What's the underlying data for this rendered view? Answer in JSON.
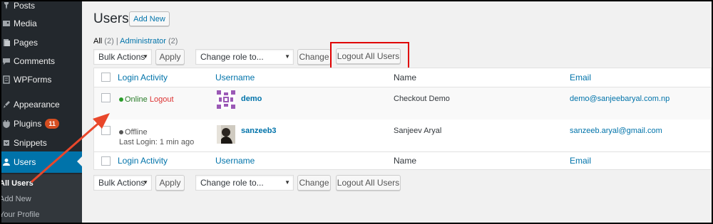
{
  "sidebar": {
    "items": [
      {
        "label": "Posts",
        "icon": "pin-icon"
      },
      {
        "label": "Media",
        "icon": "media-icon"
      },
      {
        "label": "Pages",
        "icon": "pages-icon"
      },
      {
        "label": "Comments",
        "icon": "comments-icon"
      },
      {
        "label": "WPForms",
        "icon": "forms-icon"
      },
      {
        "label": "Appearance",
        "icon": "appearance-icon"
      },
      {
        "label": "Plugins",
        "icon": "plugins-icon",
        "badge": "11"
      },
      {
        "label": "Snippets",
        "icon": "snippets-icon"
      },
      {
        "label": "Users",
        "icon": "users-icon",
        "current": true
      }
    ],
    "submenu": [
      "All Users",
      "Add New",
      "Your Profile"
    ]
  },
  "page": {
    "title": "Users",
    "add_new_label": "Add New"
  },
  "filters": {
    "all_label": "All",
    "all_count": "(2)",
    "separator": "|",
    "admin_label": "Administrator",
    "admin_count": "(2)"
  },
  "top_actions": {
    "bulk_actions": "Bulk Actions",
    "apply": "Apply",
    "change_role": "Change role to...",
    "change": "Change",
    "logout_all": "Logout All Users"
  },
  "bottom_actions": {
    "bulk_actions": "Bulk Actions",
    "apply": "Apply",
    "change_role": "Change role to...",
    "change": "Change",
    "logout_all": "Logout All Users"
  },
  "table": {
    "columns": [
      "Login Activity",
      "Username",
      "Name",
      "Email"
    ],
    "rows": [
      {
        "status": "Online",
        "status_color": "#2a9d2a",
        "action": "Logout",
        "last_login": "",
        "username": "demo",
        "name": "Checkout Demo",
        "email": "demo@sanjeebaryal.com.np"
      },
      {
        "status": "Offline",
        "status_color": "#555555",
        "action": "",
        "last_login": "Last Login: 1 min ago",
        "username": "sanzeeb3",
        "name": "Sanjeev Aryal",
        "email": "sanzeeb.aryal@gmail.com"
      }
    ]
  },
  "colors": {
    "accent": "#0073aa",
    "sidebar_bg": "#23282d",
    "annotation": "#e00000",
    "badge": "#d54e21"
  }
}
